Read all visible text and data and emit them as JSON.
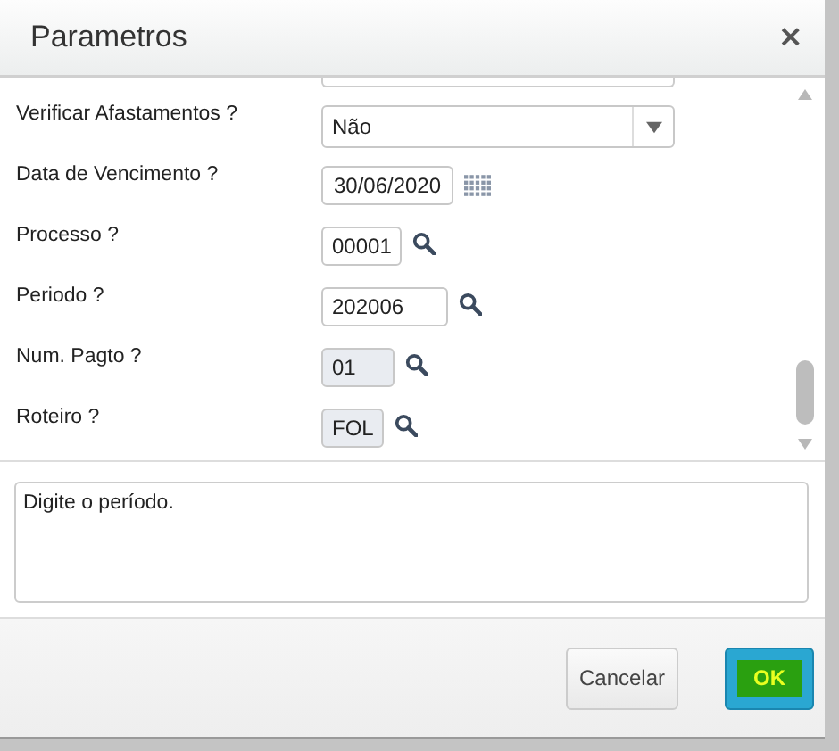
{
  "window": {
    "title": "Parametros",
    "close": "×"
  },
  "fields": [
    {
      "label": "Verificar Afastamentos ?",
      "kind": "select",
      "value": "Não",
      "disabled": false
    },
    {
      "label": "Data de Vencimento ?",
      "kind": "date",
      "value": "30/06/2020",
      "disabled": false
    },
    {
      "label": "Processo ?",
      "kind": "lookup",
      "value": "00001",
      "disabled": false
    },
    {
      "label": "Periodo ?",
      "kind": "lookup",
      "value": "202006",
      "disabled": false
    },
    {
      "label": "Num. Pagto ?",
      "kind": "lookup",
      "value": "01",
      "disabled": true
    },
    {
      "label": "Roteiro ?",
      "kind": "lookup",
      "value": "FOL",
      "disabled": true
    }
  ],
  "help": "Digite o período.",
  "buttons": [
    {
      "label": "Cancelar",
      "kind": "secondary"
    },
    {
      "label": "OK",
      "kind": "primary"
    }
  ]
}
